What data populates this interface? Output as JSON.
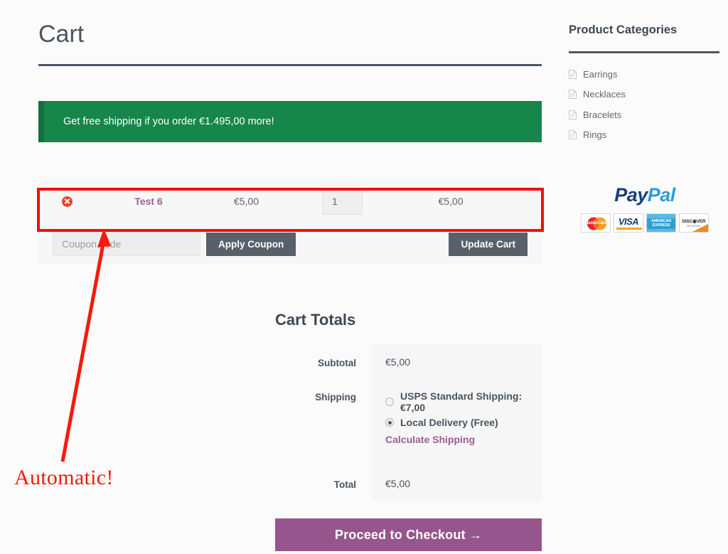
{
  "page": {
    "title": "Cart"
  },
  "notice": {
    "free_shipping_message": "Get free shipping if you order €1.495,00 more!"
  },
  "cart": {
    "items": [
      {
        "remove_icon": "remove-circle-icon",
        "name": "Test 6",
        "price": "€5,00",
        "quantity": "1",
        "subtotal": "€5,00"
      }
    ],
    "coupon_placeholder": "Coupon code",
    "coupon_value": "",
    "apply_coupon_label": "Apply Coupon",
    "update_cart_label": "Update Cart"
  },
  "totals": {
    "heading": "Cart Totals",
    "subtotal_label": "Subtotal",
    "subtotal_value": "€5,00",
    "shipping_label": "Shipping",
    "shipping_options": [
      {
        "label": "USPS Standard Shipping: €7,00",
        "selected": false
      },
      {
        "label": "Local Delivery (Free)",
        "selected": true
      }
    ],
    "calculate_shipping_label": "Calculate Shipping",
    "total_label": "Total",
    "total_value": "€5,00",
    "checkout_label": "Proceed to Checkout  →"
  },
  "sidebar": {
    "categories_title": "Product Categories",
    "categories": [
      {
        "label": "Earrings",
        "icon": "document-icon"
      },
      {
        "label": "Necklaces",
        "icon": "document-icon"
      },
      {
        "label": "Bracelets",
        "icon": "document-icon"
      },
      {
        "label": "Rings",
        "icon": "document-icon"
      }
    ],
    "paypal": {
      "logo_part1": "Pay",
      "logo_part2": "Pal",
      "cards": [
        {
          "name": "MasterCard",
          "label": "MasterCard"
        },
        {
          "name": "VISA",
          "label": "VISA"
        },
        {
          "name": "American Express",
          "label": "AMERICAN EXPRESS"
        },
        {
          "name": "Discover",
          "label": "DISC◉VER",
          "sublabel": "NETWORK"
        }
      ]
    }
  },
  "annotation": {
    "label": "Automatic!",
    "color": "#f41b0c",
    "highlight_color": "#fb0a08"
  }
}
